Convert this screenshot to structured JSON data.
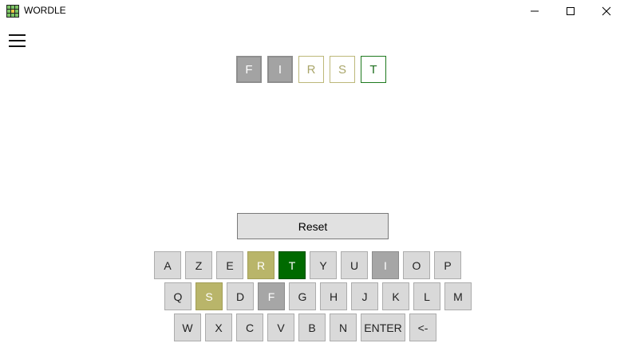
{
  "window": {
    "title": "WORDLE",
    "minimize_icon": "minimize-icon",
    "maximize_icon": "maximize-icon",
    "close_icon": "close-icon"
  },
  "menu": {
    "icon": "hamburger-menu-icon"
  },
  "guess": {
    "tiles": [
      {
        "letter": "F",
        "state": "absent"
      },
      {
        "letter": "I",
        "state": "absent"
      },
      {
        "letter": "R",
        "state": "present"
      },
      {
        "letter": "S",
        "state": "present"
      },
      {
        "letter": "T",
        "state": "correct"
      }
    ]
  },
  "reset_label": "Reset",
  "keyboard": {
    "row1": [
      "A",
      "Z",
      "E",
      "R",
      "T",
      "Y",
      "U",
      "I",
      "O",
      "P"
    ],
    "row2": [
      "Q",
      "S",
      "D",
      "F",
      "G",
      "H",
      "J",
      "K",
      "L",
      "M"
    ],
    "row3": [
      "W",
      "X",
      "C",
      "V",
      "B",
      "N",
      "ENTER",
      "<-"
    ],
    "key_states": {
      "R": "present",
      "T": "correct",
      "I": "absent",
      "S": "present",
      "F": "absent"
    }
  },
  "colors": {
    "absent": "#a6a6a6",
    "present": "#b9b56a",
    "correct": "#006a00",
    "key_default": "#d9d9d9"
  }
}
